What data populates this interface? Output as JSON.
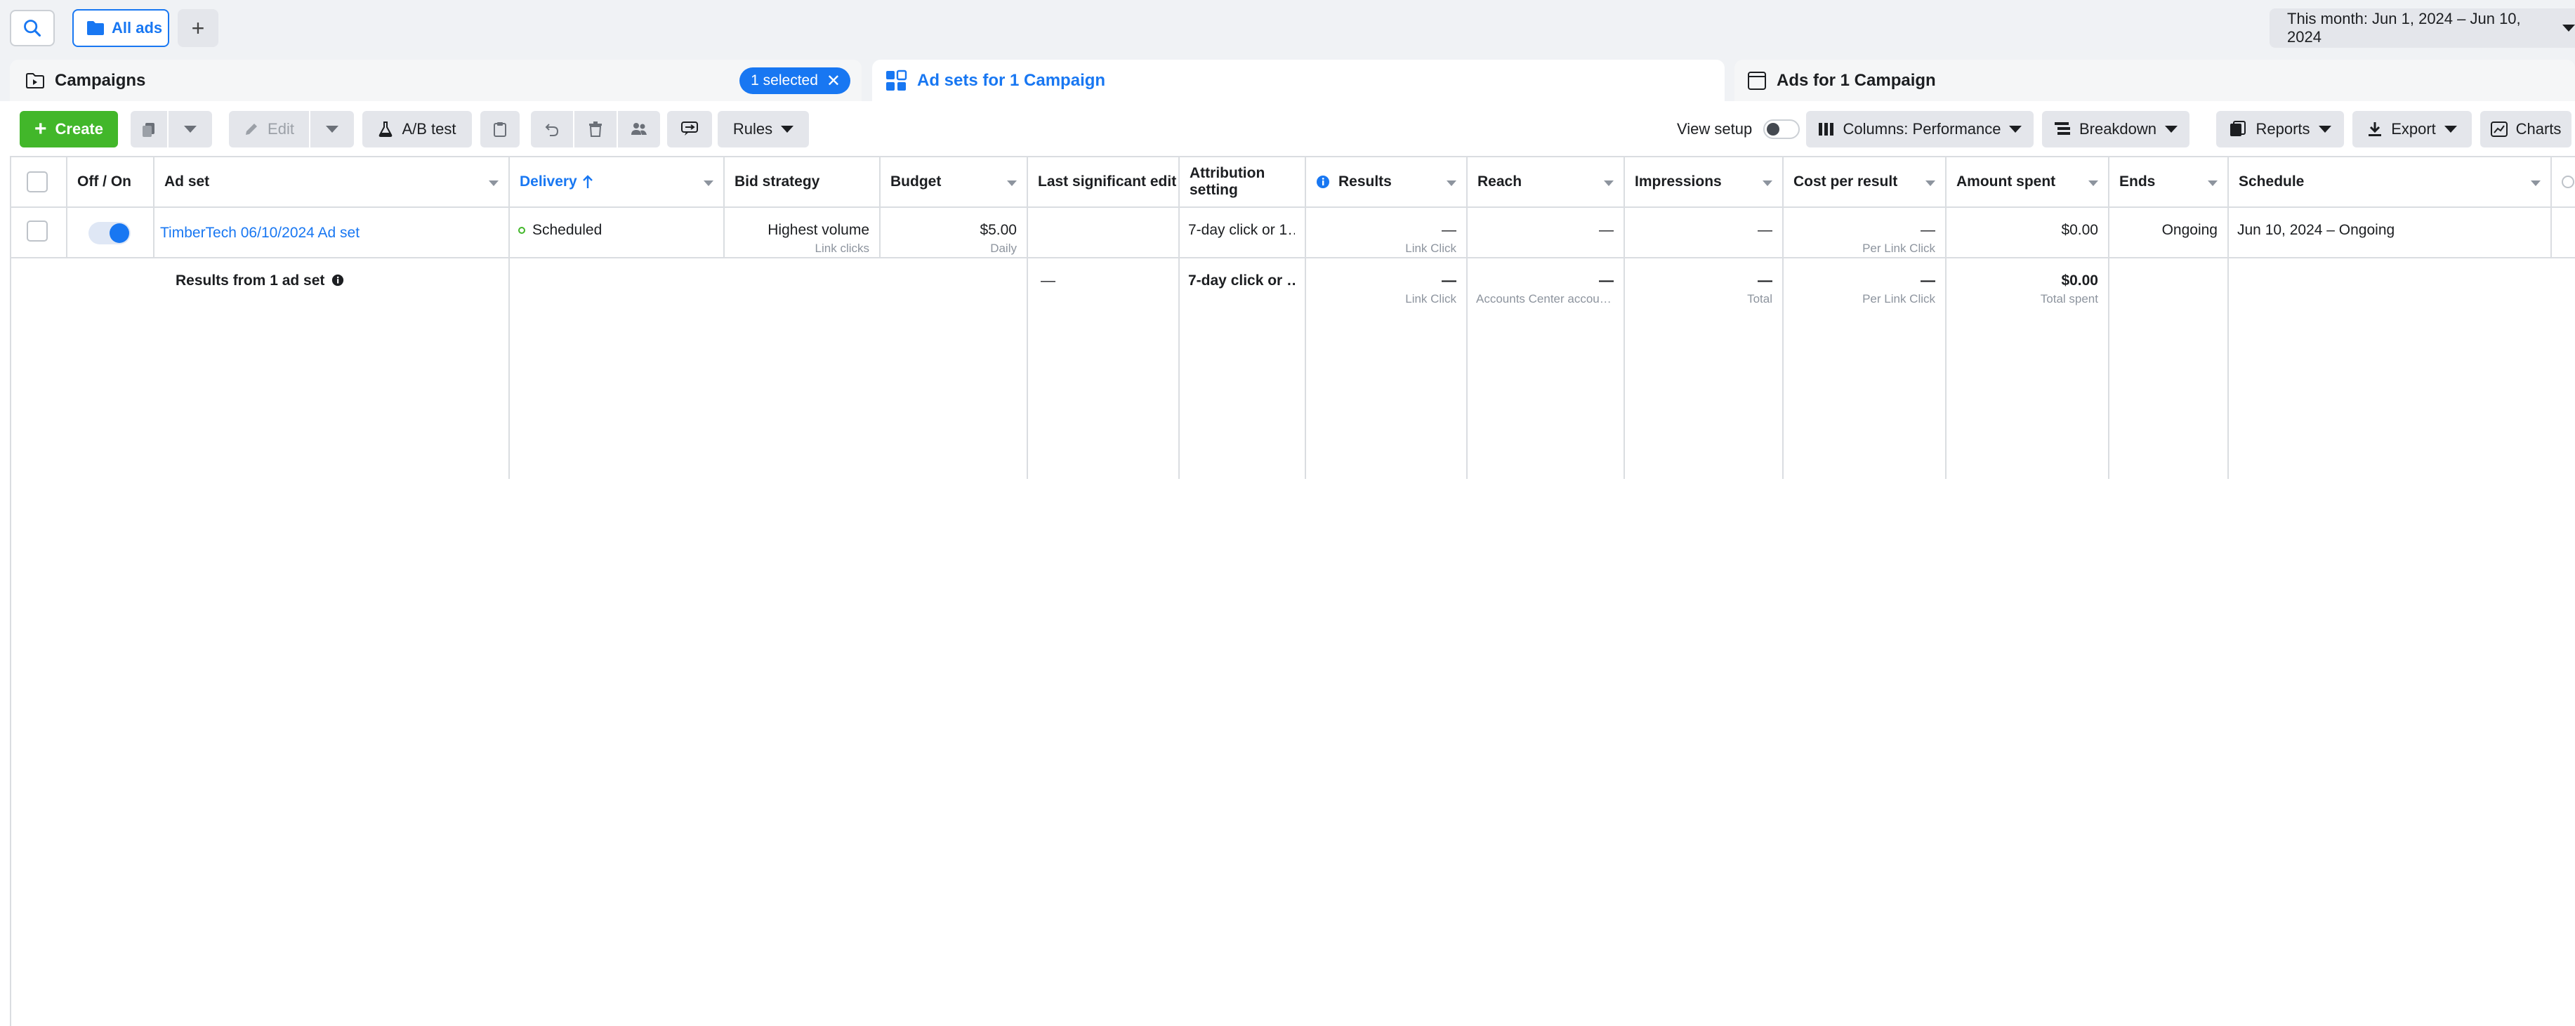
{
  "topbar": {
    "all_ads_label": "All ads",
    "date_range": "This month: Jun 1, 2024 – Jun 10, 2024"
  },
  "level_tabs": {
    "campaigns": "Campaigns",
    "selected_pill": "1 selected",
    "ad_sets": "Ad sets for 1 Campaign",
    "ads": "Ads for 1 Campaign"
  },
  "toolbar": {
    "create": "Create",
    "edit": "Edit",
    "ab_test": "A/B test",
    "rules": "Rules",
    "view_setup": "View setup",
    "columns": "Columns: Performance",
    "breakdown": "Breakdown",
    "reports": "Reports",
    "export": "Export",
    "charts": "Charts"
  },
  "table": {
    "headers": {
      "off_on": "Off / On",
      "ad_set": "Ad set",
      "delivery": "Delivery",
      "bid_strategy": "Bid strategy",
      "budget": "Budget",
      "last_edit": "Last significant edit",
      "attribution": "Attribution setting",
      "results": "Results",
      "reach": "Reach",
      "impressions": "Impressions",
      "cost_per_result": "Cost per result",
      "amount_spent": "Amount spent",
      "ends": "Ends",
      "schedule": "Schedule"
    },
    "row": {
      "name": "TimberTech 06/10/2024 Ad set",
      "delivery": "Scheduled",
      "bid_strategy": "Highest volume",
      "bid_strategy_sub": "Link clicks",
      "budget": "$5.00",
      "budget_sub": "Daily",
      "attribution": "7-day click or 1…",
      "results": "—",
      "results_sub": "Link Click",
      "reach": "—",
      "impressions": "—",
      "cost_per_result": "—",
      "cost_per_result_sub": "Per Link Click",
      "amount_spent": "$0.00",
      "ends": "Ongoing",
      "schedule": "Jun 10, 2024 – Ongoing"
    },
    "summary": {
      "label": "Results from 1 ad set",
      "last_edit": "—",
      "attribution": "7-day click or …",
      "results": "—",
      "results_sub": "Link Click",
      "reach": "—",
      "reach_sub": "Accounts Center accou…",
      "impressions": "—",
      "impressions_sub": "Total",
      "cost_per_result": "—",
      "cost_per_result_sub": "Per Link Click",
      "amount_spent": "$0.00",
      "amount_spent_sub": "Total spent"
    }
  },
  "colors": {
    "accent": "#1877f2",
    "create_green": "#42b72a",
    "scheduled_dot": "#42b72a"
  }
}
